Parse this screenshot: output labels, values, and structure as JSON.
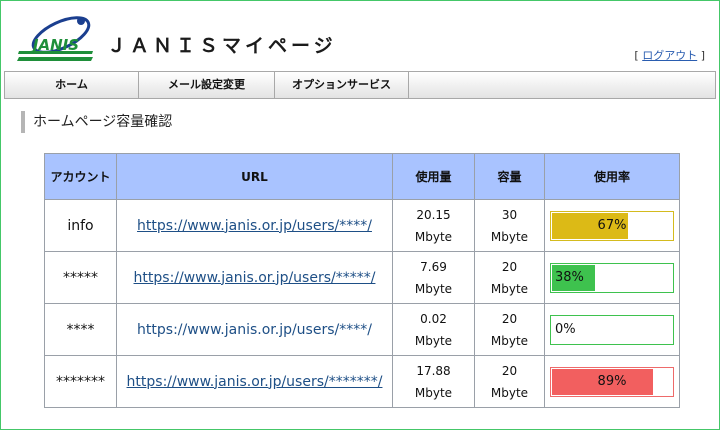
{
  "header": {
    "title": "ＪＡＮＩＳマイページ",
    "logout_prefix": "[",
    "logout_label": "ログアウト",
    "logout_suffix": "]",
    "logo_text": "JANIS"
  },
  "nav": {
    "items": [
      {
        "label": "ホーム"
      },
      {
        "label": "メール設定変更"
      },
      {
        "label": "オプションサービス"
      }
    ]
  },
  "section": {
    "title": "ホームページ容量確認"
  },
  "table": {
    "headers": {
      "account": "アカウント",
      "url": "URL",
      "used": "使用量",
      "capacity": "容量",
      "rate": "使用率"
    },
    "rows": [
      {
        "account": "info",
        "url": "https://www.janis.or.jp/users/****/",
        "used_value": "20.15",
        "used_unit": "Mbyte",
        "capacity_value": "30",
        "capacity_unit": "Mbyte",
        "rate_label": "67%",
        "rate": 67
      },
      {
        "account": "*****",
        "url": "https://www.janis.or.jp/users/*****/",
        "used_value": "7.69",
        "used_unit": "Mbyte",
        "capacity_value": "20",
        "capacity_unit": "Mbyte",
        "rate_label": "38%",
        "rate": 38
      },
      {
        "account": "****",
        "url": "https://www.janis.or.jp/users/****/",
        "used_value": "0.02",
        "used_unit": "Mbyte",
        "capacity_value": "20",
        "capacity_unit": "Mbyte",
        "rate_label": "0%",
        "rate": 0
      },
      {
        "account": "*******",
        "url": "https://www.janis.or.jp/users/*******/",
        "used_value": "17.88",
        "used_unit": "Mbyte",
        "capacity_value": "20",
        "capacity_unit": "Mbyte",
        "rate_label": "89%",
        "rate": 89
      }
    ]
  },
  "colors": {
    "frame_border": "#44c768",
    "header_bg": "#a9c3ff",
    "meter_yellow": "#dcba16",
    "meter_green": "#3ec24e",
    "meter_red": "#f25f5f",
    "link": "#1e4f86",
    "logo_green": "#1f8f3a",
    "logo_blue": "#1b3f8f"
  }
}
